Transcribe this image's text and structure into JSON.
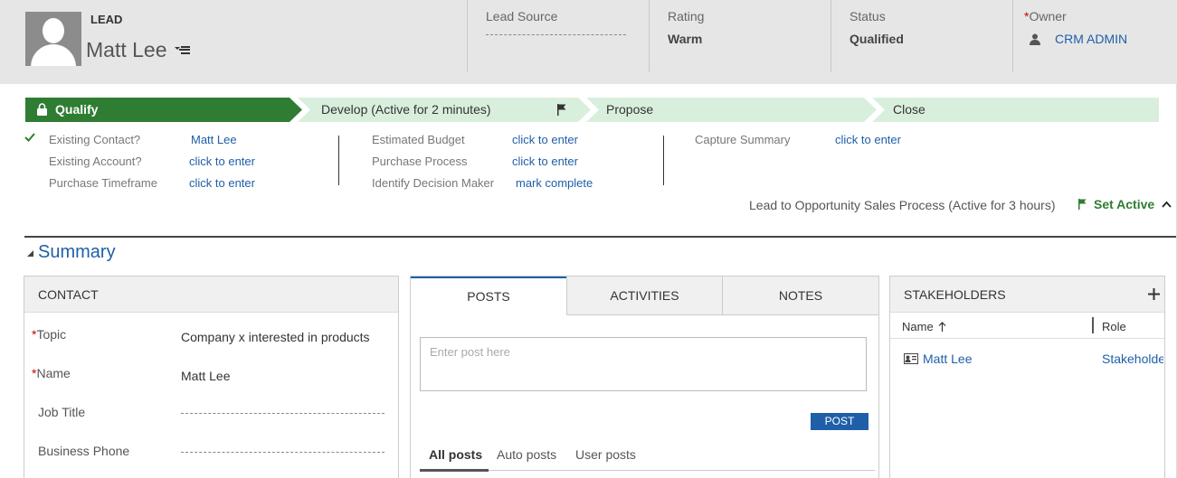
{
  "header": {
    "entity_type": "LEAD",
    "record_name": "Matt Lee",
    "fields": [
      {
        "label": "Lead Source",
        "value": ""
      },
      {
        "label": "Rating",
        "value": "Warm"
      },
      {
        "label": "Status",
        "value": "Qualified"
      }
    ],
    "owner": {
      "required_mark": "*",
      "label": "Owner",
      "value": "CRM ADMIN"
    }
  },
  "process": {
    "stages": [
      {
        "label": "Qualify",
        "state": "active"
      },
      {
        "label": "Develop (Active for 2 minutes)",
        "state": "current"
      },
      {
        "label": "Propose",
        "state": "pending"
      },
      {
        "label": "Close",
        "state": "pending"
      }
    ],
    "steps": [
      {
        "label": "Existing Contact?",
        "value": "Matt Lee"
      },
      {
        "label": "Existing Account?",
        "value": "click to enter"
      },
      {
        "label": "Purchase Timeframe",
        "value": "click to enter"
      },
      {
        "label": "Estimated Budget",
        "value": "click to enter"
      },
      {
        "label": "Purchase Process",
        "value": "click to enter"
      },
      {
        "label": "Identify Decision Maker",
        "value": "mark complete"
      },
      {
        "label": "Capture Summary",
        "value": "click to enter"
      }
    ],
    "footer": "Lead to Opportunity Sales Process (Active for 3 hours)",
    "set_active_label": "Set Active"
  },
  "summary": {
    "title": "Summary",
    "contact": {
      "heading": "CONTACT",
      "required_mark": "*",
      "fields": [
        {
          "label": "Topic",
          "value": "Company x interested in products"
        },
        {
          "label": "Name",
          "value": "Matt Lee"
        },
        {
          "label": "Job Title",
          "value": ""
        },
        {
          "label": "Business Phone",
          "value": ""
        }
      ]
    },
    "posts": {
      "tabs": [
        "POSTS",
        "ACTIVITIES",
        "NOTES"
      ],
      "placeholder": "Enter post here",
      "post_button": "POST",
      "filters": [
        "All posts",
        "Auto posts",
        "User posts"
      ]
    },
    "stakeholders": {
      "heading": "STAKEHOLDERS",
      "columns": [
        "Name",
        "Role"
      ],
      "rows": [
        {
          "name": "Matt Lee",
          "role": "Stakeholder"
        }
      ]
    }
  },
  "colors": {
    "accent": "#1f5fa8",
    "stage_active": "#2e7d32",
    "stage_pending": "#d9efdd",
    "header_bg": "#e6e6e6"
  }
}
